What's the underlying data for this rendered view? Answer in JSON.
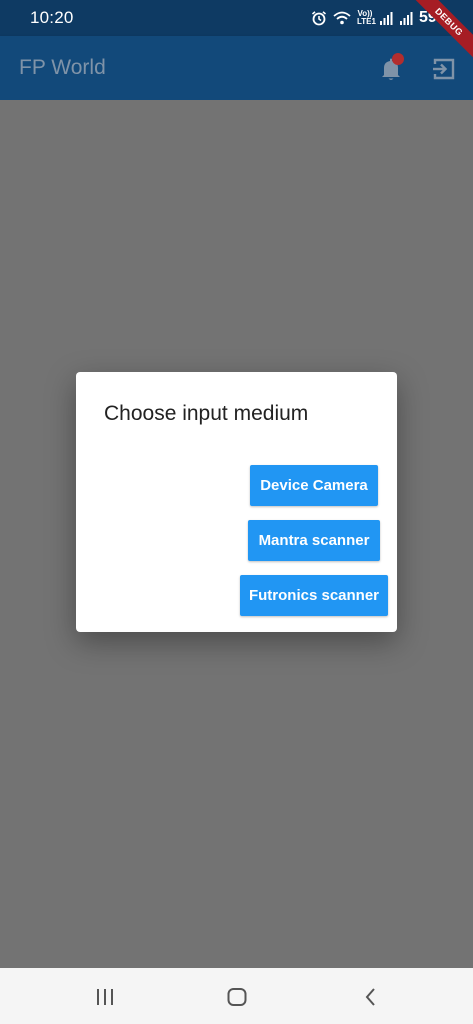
{
  "status_bar": {
    "time": "10:20",
    "volte_top": "Vo))",
    "volte_bottom": "LTE1",
    "battery": "59%",
    "icons": [
      "alarm-icon",
      "wifi-icon",
      "volte-icon",
      "signal-icon",
      "signal-icon",
      "battery-icon"
    ]
  },
  "debug_banner": "DEBUG",
  "app_bar": {
    "title": "FP World",
    "actions": [
      "notifications-icon",
      "logout-icon"
    ]
  },
  "dialog": {
    "title": "Choose input medium",
    "buttons": {
      "device_camera": "Device Camera",
      "mantra": "Mantra scanner",
      "futronics": "Futronics scanner"
    }
  },
  "nav_bar": {
    "buttons": [
      "recents-icon",
      "home-icon",
      "back-icon"
    ]
  },
  "colors": {
    "app_bar": "#12497a",
    "status_bar": "#0e3a63",
    "button": "#2196f3",
    "scrim": "#737373",
    "badge": "#b32d2d"
  }
}
